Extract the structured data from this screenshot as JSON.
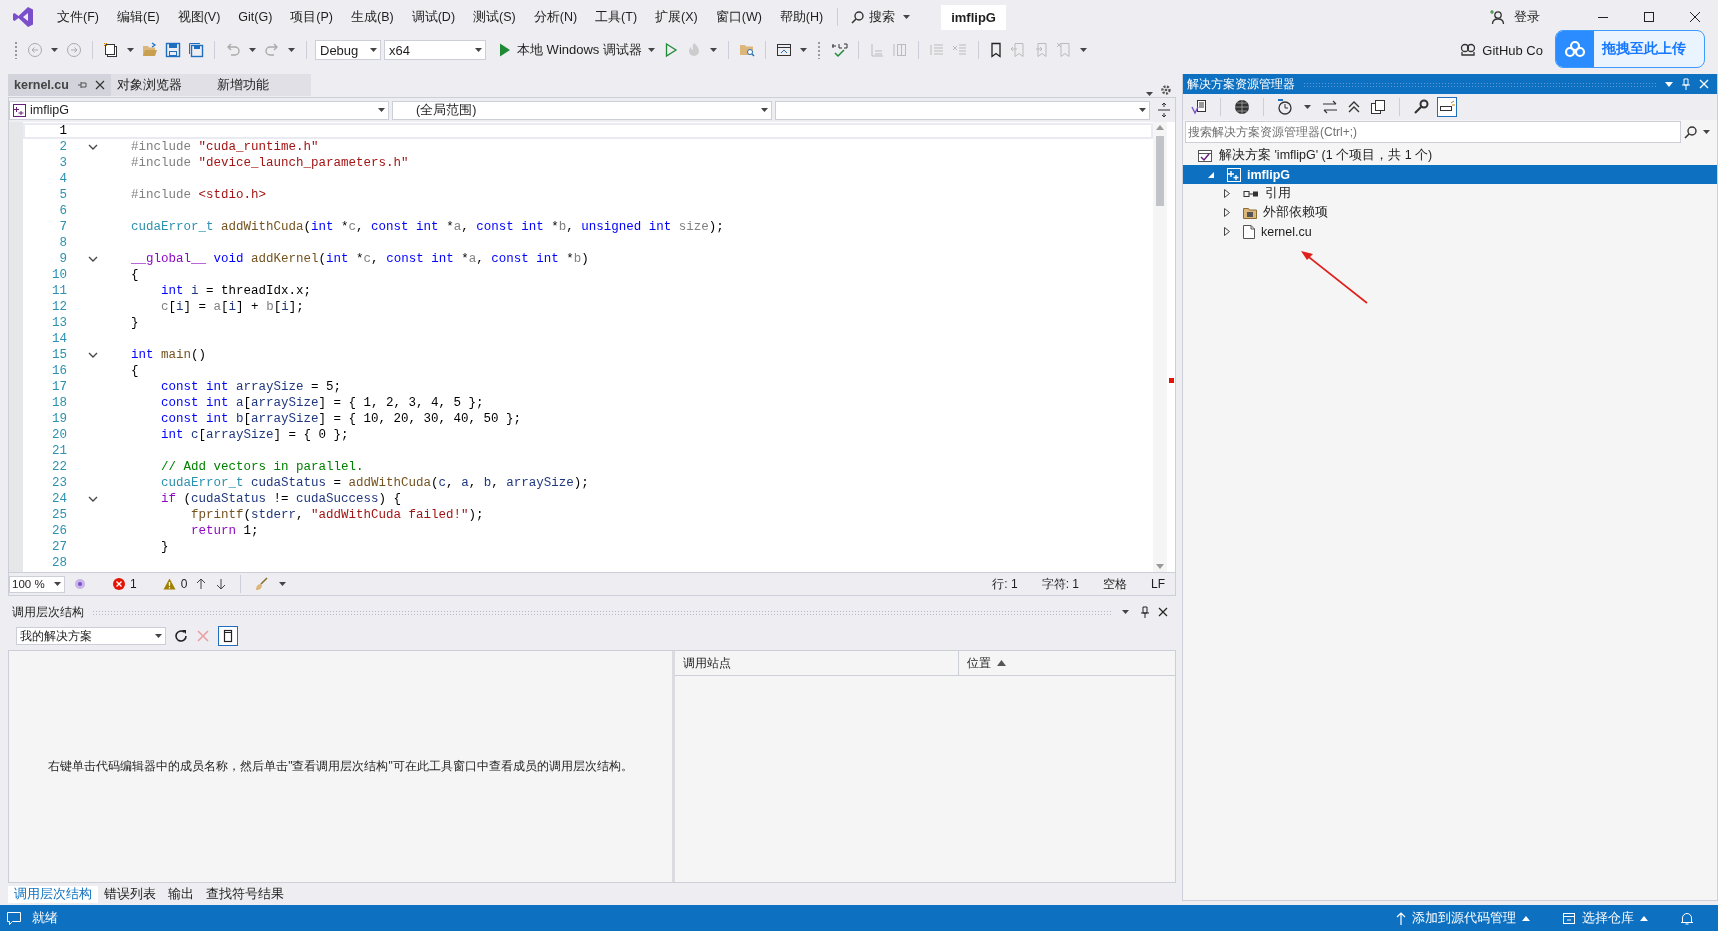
{
  "menu_bar": {
    "items": [
      "文件(F)",
      "编辑(E)",
      "视图(V)",
      "Git(G)",
      "项目(P)",
      "生成(B)",
      "调试(D)",
      "测试(S)",
      "分析(N)",
      "工具(T)",
      "扩展(X)",
      "窗口(W)",
      "帮助(H)"
    ],
    "search": "搜索",
    "solution_name": "imflipG",
    "sign_in": "登录"
  },
  "toolbar": {
    "configuration": "Debug",
    "platform": "x64",
    "run_label": "本地 Windows 调试器",
    "github": "GitHub Co"
  },
  "upload_float": {
    "label": "拖拽至此上传"
  },
  "document_tabs": [
    {
      "label": "kernel.cu",
      "selected": true
    },
    {
      "label": "对象浏览器",
      "selected": false
    },
    {
      "label": "新增功能",
      "selected": false
    }
  ],
  "nav_bar": {
    "project": "imflipG",
    "scope": "(全局范围)"
  },
  "editor": {
    "lines": [
      {
        "n": "1",
        "fold": false
      },
      {
        "n": "2",
        "fold": true,
        "tokens": [
          {
            "text": "#include",
            "kind": "pp"
          },
          {
            "text": " \"cuda_runtime.h\"",
            "kind": "str"
          }
        ]
      },
      {
        "n": "3",
        "fold": false,
        "tokens": [
          {
            "text": "#include",
            "kind": "pp"
          },
          {
            "text": " \"device_launch_parameters.h\"",
            "kind": "str"
          }
        ]
      },
      {
        "n": "4",
        "fold": false
      },
      {
        "n": "5",
        "fold": false,
        "tokens": [
          {
            "text": "#include",
            "kind": "pp"
          },
          {
            "text": " <stdio.h>",
            "kind": "str"
          }
        ]
      },
      {
        "n": "6",
        "fold": false
      },
      {
        "n": "7",
        "fold": false,
        "tokens": [
          {
            "text": "cudaError_t",
            "kind": "type"
          },
          {
            "text": " addWithCuda",
            "kind": "fn"
          },
          {
            "text": "(",
            "kind": "plain"
          },
          {
            "text": "int",
            "kind": "kw"
          },
          {
            "text": " *",
            "kind": "plain"
          },
          {
            "text": "c",
            "kind": "param"
          },
          {
            "text": ", ",
            "kind": "plain"
          },
          {
            "text": "const int",
            "kind": "kw"
          },
          {
            "text": " *",
            "kind": "plain"
          },
          {
            "text": "a",
            "kind": "param"
          },
          {
            "text": ", ",
            "kind": "plain"
          },
          {
            "text": "const int",
            "kind": "kw"
          },
          {
            "text": " *",
            "kind": "plain"
          },
          {
            "text": "b",
            "kind": "param"
          },
          {
            "text": ", ",
            "kind": "plain"
          },
          {
            "text": "unsigned int",
            "kind": "kw"
          },
          {
            "text": " size",
            "kind": "param"
          },
          {
            "text": ");",
            "kind": "plain"
          }
        ]
      },
      {
        "n": "8",
        "fold": false
      },
      {
        "n": "9",
        "fold": true,
        "tokens": [
          {
            "text": "__global__",
            "kind": "macro"
          },
          {
            "text": " void",
            "kind": "kw"
          },
          {
            "text": " addKernel",
            "kind": "fn"
          },
          {
            "text": "(",
            "kind": "plain"
          },
          {
            "text": "int",
            "kind": "kw"
          },
          {
            "text": " *",
            "kind": "plain"
          },
          {
            "text": "c",
            "kind": "param"
          },
          {
            "text": ", ",
            "kind": "plain"
          },
          {
            "text": "const int",
            "kind": "kw"
          },
          {
            "text": " *",
            "kind": "plain"
          },
          {
            "text": "a",
            "kind": "param"
          },
          {
            "text": ", ",
            "kind": "plain"
          },
          {
            "text": "const int",
            "kind": "kw"
          },
          {
            "text": " *",
            "kind": "plain"
          },
          {
            "text": "b",
            "kind": "param"
          },
          {
            "text": ")",
            "kind": "plain"
          }
        ]
      },
      {
        "n": "10",
        "fold": false,
        "tokens": [
          {
            "text": "{",
            "kind": "plain"
          }
        ]
      },
      {
        "n": "11",
        "fold": false,
        "tokens": [
          {
            "text": "    int",
            "kind": "kw"
          },
          {
            "text": " i",
            "kind": "var"
          },
          {
            "text": " = threadIdx.x;",
            "kind": "plain"
          }
        ]
      },
      {
        "n": "12",
        "fold": false,
        "tokens": [
          {
            "text": "    c",
            "kind": "param"
          },
          {
            "text": "[",
            "kind": "plain"
          },
          {
            "text": "i",
            "kind": "var"
          },
          {
            "text": "] = ",
            "kind": "plain"
          },
          {
            "text": "a",
            "kind": "param"
          },
          {
            "text": "[",
            "kind": "plain"
          },
          {
            "text": "i",
            "kind": "var"
          },
          {
            "text": "] + ",
            "kind": "plain"
          },
          {
            "text": "b",
            "kind": "param"
          },
          {
            "text": "[",
            "kind": "plain"
          },
          {
            "text": "i",
            "kind": "var"
          },
          {
            "text": "];",
            "kind": "plain"
          }
        ]
      },
      {
        "n": "13",
        "fold": false,
        "tokens": [
          {
            "text": "}",
            "kind": "plain"
          }
        ]
      },
      {
        "n": "14",
        "fold": false
      },
      {
        "n": "15",
        "fold": true,
        "tokens": [
          {
            "text": "int",
            "kind": "kw"
          },
          {
            "text": " main",
            "kind": "fn"
          },
          {
            "text": "()",
            "kind": "plain"
          }
        ]
      },
      {
        "n": "16",
        "fold": false,
        "tokens": [
          {
            "text": "{",
            "kind": "plain"
          }
        ]
      },
      {
        "n": "17",
        "fold": false,
        "tokens": [
          {
            "text": "    const int",
            "kind": "kw"
          },
          {
            "text": " arraySize",
            "kind": "var"
          },
          {
            "text": " = 5;",
            "kind": "plain"
          }
        ]
      },
      {
        "n": "18",
        "fold": false,
        "tokens": [
          {
            "text": "    const int",
            "kind": "kw"
          },
          {
            "text": " a",
            "kind": "var"
          },
          {
            "text": "[",
            "kind": "plain"
          },
          {
            "text": "arraySize",
            "kind": "var"
          },
          {
            "text": "] = { 1, 2, 3, 4, 5 };",
            "kind": "plain"
          }
        ]
      },
      {
        "n": "19",
        "fold": false,
        "tokens": [
          {
            "text": "    const int",
            "kind": "kw"
          },
          {
            "text": " b",
            "kind": "var"
          },
          {
            "text": "[",
            "kind": "plain"
          },
          {
            "text": "arraySize",
            "kind": "var"
          },
          {
            "text": "] = { 10, 20, 30, 40, 50 };",
            "kind": "plain"
          }
        ]
      },
      {
        "n": "20",
        "fold": false,
        "tokens": [
          {
            "text": "    int",
            "kind": "kw"
          },
          {
            "text": " c",
            "kind": "var"
          },
          {
            "text": "[",
            "kind": "plain"
          },
          {
            "text": "arraySize",
            "kind": "var"
          },
          {
            "text": "] = { 0 };",
            "kind": "plain"
          }
        ]
      },
      {
        "n": "21",
        "fold": false
      },
      {
        "n": "22",
        "fold": false,
        "tokens": [
          {
            "text": "    // Add vectors in parallel.",
            "kind": "cm"
          }
        ]
      },
      {
        "n": "23",
        "fold": false,
        "tokens": [
          {
            "text": "    cudaError_t",
            "kind": "type"
          },
          {
            "text": " cudaStatus",
            "kind": "var"
          },
          {
            "text": " = ",
            "kind": "plain"
          },
          {
            "text": "addWithCuda",
            "kind": "fn"
          },
          {
            "text": "(",
            "kind": "plain"
          },
          {
            "text": "c",
            "kind": "var"
          },
          {
            "text": ", ",
            "kind": "plain"
          },
          {
            "text": "a",
            "kind": "var"
          },
          {
            "text": ", ",
            "kind": "plain"
          },
          {
            "text": "b",
            "kind": "var"
          },
          {
            "text": ", ",
            "kind": "plain"
          },
          {
            "text": "arraySize",
            "kind": "var"
          },
          {
            "text": ");",
            "kind": "plain"
          }
        ]
      },
      {
        "n": "24",
        "fold": true,
        "tokens": [
          {
            "text": "    if",
            "kind": "macro"
          },
          {
            "text": " (",
            "kind": "plain"
          },
          {
            "text": "cudaStatus",
            "kind": "var"
          },
          {
            "text": " != ",
            "kind": "plain"
          },
          {
            "text": "cudaSuccess",
            "kind": "var"
          },
          {
            "text": ") {",
            "kind": "plain"
          }
        ]
      },
      {
        "n": "25",
        "fold": false,
        "tokens": [
          {
            "text": "        fprintf",
            "kind": "fn"
          },
          {
            "text": "(",
            "kind": "plain"
          },
          {
            "text": "stderr",
            "kind": "var"
          },
          {
            "text": ", ",
            "kind": "plain"
          },
          {
            "text": "\"addWithCuda failed!\"",
            "kind": "str"
          },
          {
            "text": ");",
            "kind": "plain"
          }
        ]
      },
      {
        "n": "26",
        "fold": false,
        "tokens": [
          {
            "text": "        return",
            "kind": "macro"
          },
          {
            "text": " 1;",
            "kind": "plain"
          }
        ]
      },
      {
        "n": "27",
        "fold": false,
        "tokens": [
          {
            "text": "    }",
            "kind": "plain"
          }
        ]
      },
      {
        "n": "28",
        "fold": false
      }
    ]
  },
  "editor_status": {
    "zoom": "100 %",
    "errors": "1",
    "warnings": "0",
    "line": "行: 1",
    "char": "字符: 1",
    "whitespace": "空格",
    "eol": "LF"
  },
  "call_hierarchy": {
    "title": "调用层次结构",
    "scope": "我的解决方案",
    "hint": "右键单击代码编辑器中的成员名称，然后单击\"查看调用层次结构\"可在此工具窗口中查看成员的调用层次结构。",
    "columns": [
      "调用站点",
      "位置"
    ]
  },
  "bottom_tabs": [
    {
      "label": "调用层次结构",
      "selected": true
    },
    {
      "label": "错误列表",
      "selected": false
    },
    {
      "label": "输出",
      "selected": false
    },
    {
      "label": "查找符号结果",
      "selected": false
    }
  ],
  "solution_explorer": {
    "title": "解决方案资源管理器",
    "search_placeholder": "搜索解决方案资源管理器(Ctrl+;)",
    "tree": [
      {
        "label": "解决方案 'imflipG' (1 个项目，共 1 个)",
        "kind": "solution",
        "selected": false,
        "children": [
          {
            "label": "imflipG",
            "kind": "project",
            "expanded": true,
            "selected": true,
            "children": [
              {
                "label": "引用",
                "kind": "references",
                "expanded": false,
                "selected": false
              },
              {
                "label": "外部依赖项",
                "kind": "dependencies",
                "expanded": false,
                "selected": false
              },
              {
                "label": "kernel.cu",
                "kind": "file",
                "expanded": false,
                "selected": false
              }
            ]
          }
        ]
      }
    ]
  },
  "status_bar": {
    "status": "就绪",
    "source_control": "添加到源代码管理",
    "repo": "选择仓库"
  }
}
